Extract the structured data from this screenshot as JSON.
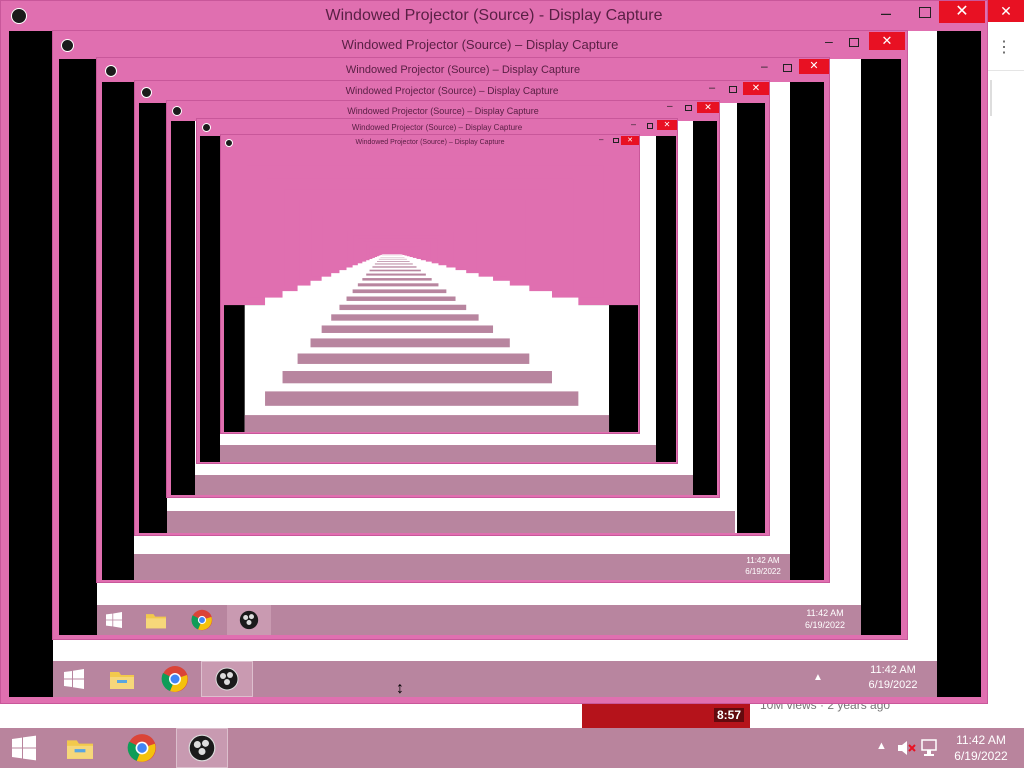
{
  "window": {
    "title": "Windowed Projector (Source) - Display Capture",
    "title_nested": "Windowed Projector (Source) – Display Capture",
    "minimize_label": "–",
    "close_label": "✕"
  },
  "background_page": {
    "close_label": "✕",
    "kebab_label": "⋮",
    "video_duration": "8:57",
    "video_meta": "10M views · 2 years ago"
  },
  "taskbar": {
    "pinned": [
      "windows-start",
      "file-explorer",
      "chrome",
      "obs-studio"
    ],
    "tray_up": "▲",
    "time": "11:42 AM",
    "date": "6/19/2022"
  },
  "colors": {
    "window_frame": "#e06fb0",
    "taskbar": "#b9849d",
    "close": "#e81123"
  }
}
